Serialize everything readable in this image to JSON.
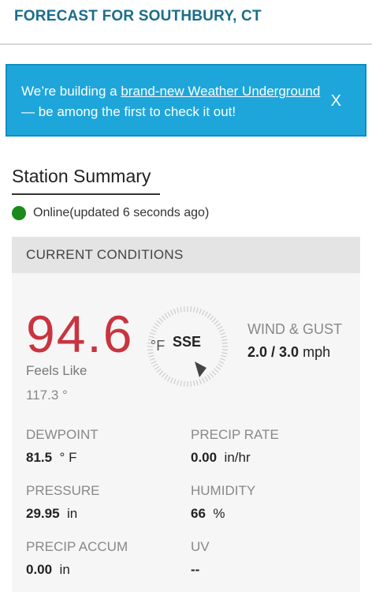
{
  "header": {
    "title": "FORECAST FOR SOUTHBURY, CT"
  },
  "banner": {
    "prefix": "We’re building a ",
    "link": "brand-new Weather Underground",
    "suffix": " — be among the first to check it out!",
    "close": "X"
  },
  "station": {
    "title": "Station Summary",
    "status": "Online(updated 6 seconds ago)",
    "status_color": "#1a8a1a"
  },
  "conditions": {
    "header": "CURRENT CONDITIONS",
    "temperature": "94.6",
    "temp_unit": "°F",
    "feels_like_label": "Feels Like",
    "feels_like_value": "117.3 °",
    "wind_direction": "SSE",
    "wind_label": "WIND & GUST",
    "wind_value": "2.0",
    "wind_sep": " / ",
    "gust_value": "3.0",
    "wind_unit": "mph",
    "dewpoint_label": "DEWPOINT",
    "dewpoint_value": "81.5",
    "dewpoint_unit": "° F",
    "precip_rate_label": "PRECIP RATE",
    "precip_rate_value": "0.00",
    "precip_rate_unit": "in/hr",
    "pressure_label": "PRESSURE",
    "pressure_value": "29.95",
    "pressure_unit": "in",
    "humidity_label": "HUMIDITY",
    "humidity_value": "66",
    "humidity_unit": "%",
    "precip_accum_label": "PRECIP ACCUM",
    "precip_accum_value": "0.00",
    "precip_accum_unit": "in",
    "uv_label": "UV",
    "uv_value": "--"
  },
  "colors": {
    "temperature": "#c8343f",
    "banner": "#1ea6db",
    "header_title": "#1a6d8c"
  }
}
